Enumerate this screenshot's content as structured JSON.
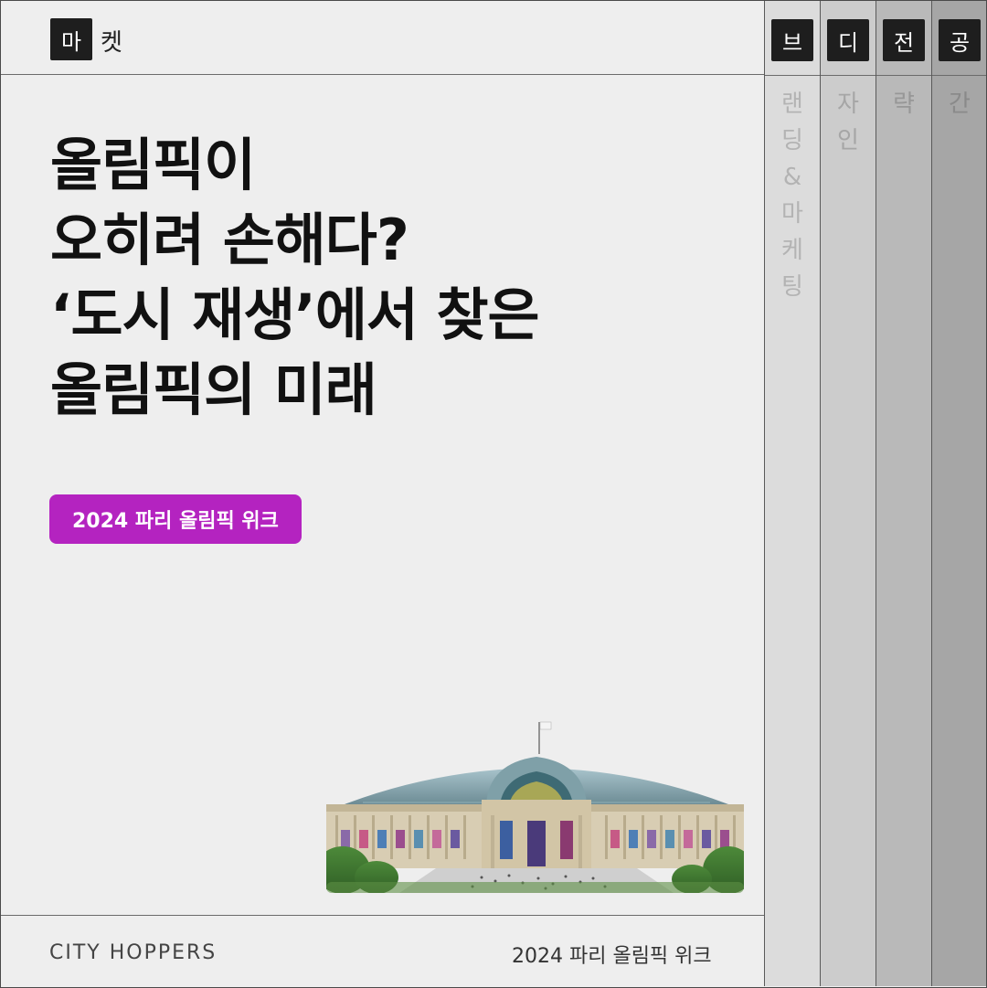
{
  "header": {
    "mark": "마",
    "rest": "켓"
  },
  "headline": {
    "lines": [
      "올림픽이",
      "오히려 손해다?",
      "‘도시 재생’에서 찾은",
      "올림픽의 미래"
    ]
  },
  "tag": {
    "label": "2024 파리 올림픽 위크"
  },
  "footer": {
    "logo": "CITY HOPPERS",
    "right_text": "2024 파리 올림픽 위크"
  },
  "columns": [
    {
      "head": "브",
      "chars": [
        "랜",
        "딩",
        "&",
        "마",
        "케",
        "팅"
      ]
    },
    {
      "head": "디",
      "chars": [
        "자",
        "인"
      ]
    },
    {
      "head": "전",
      "chars": [
        "략"
      ]
    },
    {
      "head": "공",
      "chars": [
        "간"
      ]
    }
  ],
  "colors": {
    "tag": "#b423c0",
    "dark": "#1e1e1e",
    "col1_bg": "#dcdcdc",
    "col2_bg": "#cccccc",
    "col3_bg": "#b9b9b9",
    "col4_bg": "#a6a6a6"
  }
}
